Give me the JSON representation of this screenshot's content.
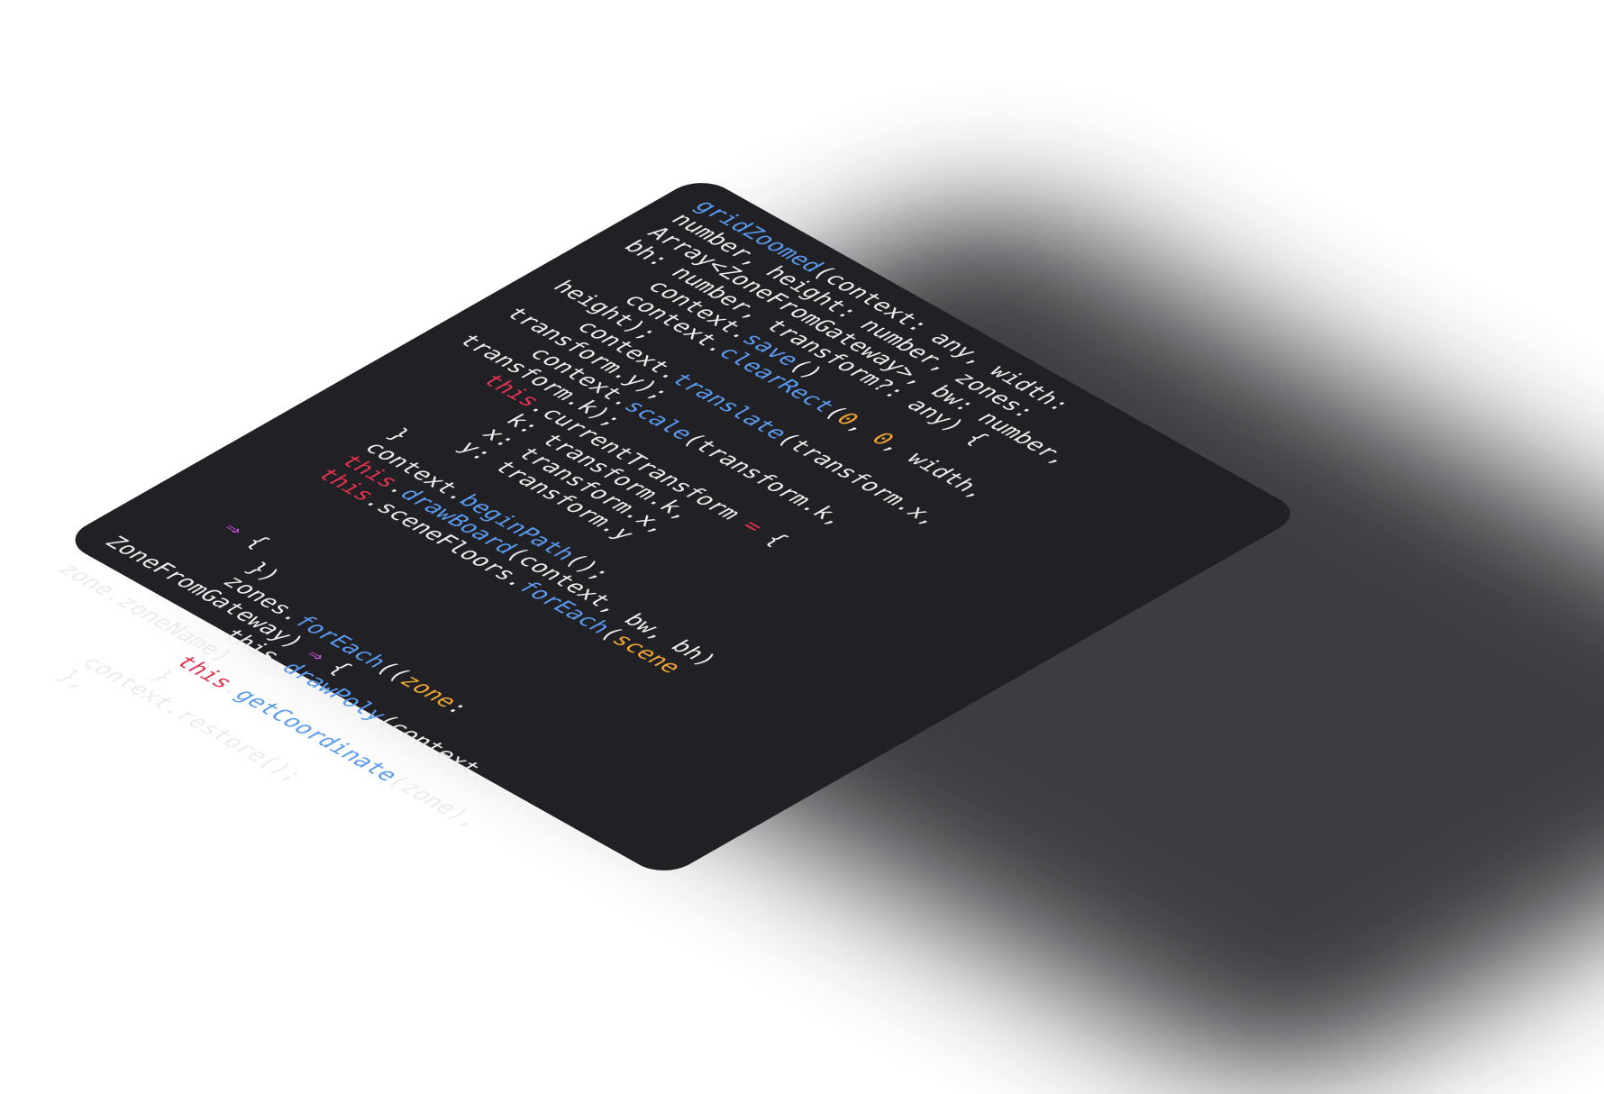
{
  "code_lines": [
    [
      {
        "t": "gridZoomed",
        "c": "fn"
      },
      {
        "t": "(context: any, width:",
        "c": "plain"
      }
    ],
    [
      {
        "t": "number, height: number, zones:",
        "c": "plain"
      }
    ],
    [
      {
        "t": "Array<ZoneFromGateway>, bw: number,",
        "c": "plain"
      }
    ],
    [
      {
        "t": "bh: number, transform?: any) {",
        "c": "plain"
      }
    ],
    [
      {
        "t": "    context.",
        "c": "plain"
      },
      {
        "t": "save",
        "c": "fn"
      },
      {
        "t": "()",
        "c": "plain"
      }
    ],
    [
      {
        "t": "    context.",
        "c": "plain"
      },
      {
        "t": "clearRect",
        "c": "fn"
      },
      {
        "t": "(",
        "c": "plain"
      },
      {
        "t": "0",
        "c": "num"
      },
      {
        "t": ", ",
        "c": "plain"
      },
      {
        "t": "0",
        "c": "num"
      },
      {
        "t": ", width,",
        "c": "plain"
      }
    ],
    [
      {
        "t": "height);",
        "c": "plain"
      }
    ],
    [
      {
        "t": "    context.",
        "c": "plain"
      },
      {
        "t": "translate",
        "c": "fn"
      },
      {
        "t": "(transform.x,",
        "c": "plain"
      }
    ],
    [
      {
        "t": "transform.y);",
        "c": "plain"
      }
    ],
    [
      {
        "t": "    context.",
        "c": "plain"
      },
      {
        "t": "scale",
        "c": "fn"
      },
      {
        "t": "(transform.k,",
        "c": "plain"
      }
    ],
    [
      {
        "t": "transform.k);",
        "c": "plain"
      }
    ],
    [
      {
        "t": "    ",
        "c": "plain"
      },
      {
        "t": "this",
        "c": "kw"
      },
      {
        "t": ".currentTransform ",
        "c": "plain"
      },
      {
        "t": "=",
        "c": "kw"
      },
      {
        "t": " {",
        "c": "plain"
      }
    ],
    [
      {
        "t": "        k: transform.k,",
        "c": "plain"
      }
    ],
    [
      {
        "t": "        x: transform.x,",
        "c": "plain"
      }
    ],
    [
      {
        "t": "        y: transform.y",
        "c": "plain"
      }
    ],
    [
      {
        "t": "    }",
        "c": "plain"
      }
    ],
    [
      {
        "t": "    context.",
        "c": "plain"
      },
      {
        "t": "beginPath",
        "c": "fn"
      },
      {
        "t": "();",
        "c": "plain"
      }
    ],
    [
      {
        "t": "    ",
        "c": "plain"
      },
      {
        "t": "this",
        "c": "kw"
      },
      {
        "t": ".",
        "c": "plain"
      },
      {
        "t": "drawBoard",
        "c": "fn"
      },
      {
        "t": "(context, bw, bh)",
        "c": "plain"
      }
    ],
    [
      {
        "t": "    ",
        "c": "plain"
      },
      {
        "t": "this",
        "c": "kw"
      },
      {
        "t": ".sceneFloors.",
        "c": "plain"
      },
      {
        "t": "forEach",
        "c": "fn"
      },
      {
        "t": "(",
        "c": "plain"
      },
      {
        "t": "scene",
        "c": "param"
      }
    ],
    [
      {
        "t": "",
        "c": "plain"
      }
    ],
    [
      {
        "t": "",
        "c": "plain"
      }
    ],
    [
      {
        "t": "",
        "c": "plain"
      }
    ],
    [
      {
        "t": "    ",
        "c": "plain"
      },
      {
        "t": "⇒",
        "c": "op"
      },
      {
        "t": " {",
        "c": "plain"
      }
    ],
    [
      {
        "t": "        })",
        "c": "plain"
      }
    ],
    [
      {
        "t": "        zones.",
        "c": "plain"
      },
      {
        "t": "forEach",
        "c": "fn"
      },
      {
        "t": "((",
        "c": "plain"
      },
      {
        "t": "zone",
        "c": "param"
      },
      {
        "t": ":",
        "c": "plain"
      }
    ],
    [
      {
        "t": "ZoneFromGateway) ",
        "c": "plain"
      },
      {
        "t": "⇒",
        "c": "op"
      },
      {
        "t": " {",
        "c": "plain"
      }
    ],
    [
      {
        "t": "            this.",
        "c": "plain"
      },
      {
        "t": "drawPoly",
        "c": "fn"
      },
      {
        "t": "(context,",
        "c": "plain"
      }
    ],
    [
      {
        "t": "zone.zoneName)",
        "c": "plain"
      }
    ],
    [
      {
        "t": "            ",
        "c": "plain"
      },
      {
        "t": "this",
        "c": "kw"
      },
      {
        "t": ".",
        "c": "plain"
      },
      {
        "t": "getCoordinate",
        "c": "fn"
      },
      {
        "t": "(zone),",
        "c": "plain"
      }
    ],
    [
      {
        "t": "            }",
        "c": "plain"
      }
    ],
    [
      {
        "t": "        context.restore();",
        "c": "plain"
      }
    ],
    [
      {
        "t": "        },",
        "c": "plain"
      }
    ]
  ],
  "colors": {
    "card_background": "#212024",
    "function": "#5b9bef",
    "keyword": "#e0354f",
    "number": "#f0a734",
    "arrow": "#c953d9",
    "plain": "#ececec"
  }
}
